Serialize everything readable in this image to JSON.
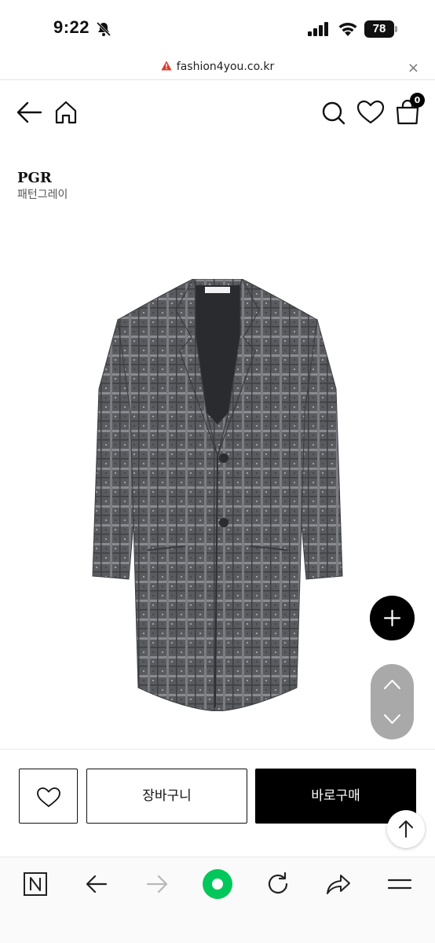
{
  "status": {
    "time": "9:22",
    "battery": "78"
  },
  "url_bar": {
    "url": "fashion4you.co.kr",
    "close": "×"
  },
  "header": {
    "cart_count": "0",
    "icons": [
      "back-arrow-icon",
      "home-icon",
      "search-icon",
      "heart-icon",
      "cart-icon"
    ]
  },
  "product": {
    "brand": "PGR",
    "color_name": "패턴그레이",
    "image": "grey-glen-check-wool-coat"
  },
  "actions": {
    "cart_label": "장바구니",
    "buy_label": "바로구매"
  },
  "toolbar": {
    "icons": [
      "naver-n-icon",
      "back-icon",
      "forward-icon",
      "green-dot-icon",
      "reload-icon",
      "share-icon",
      "menu-icon"
    ]
  },
  "colors": {
    "accent": "#000000",
    "nav_green": "#03c75a",
    "warning": "#e0382d",
    "fab_gray": "#a9a9a9"
  }
}
